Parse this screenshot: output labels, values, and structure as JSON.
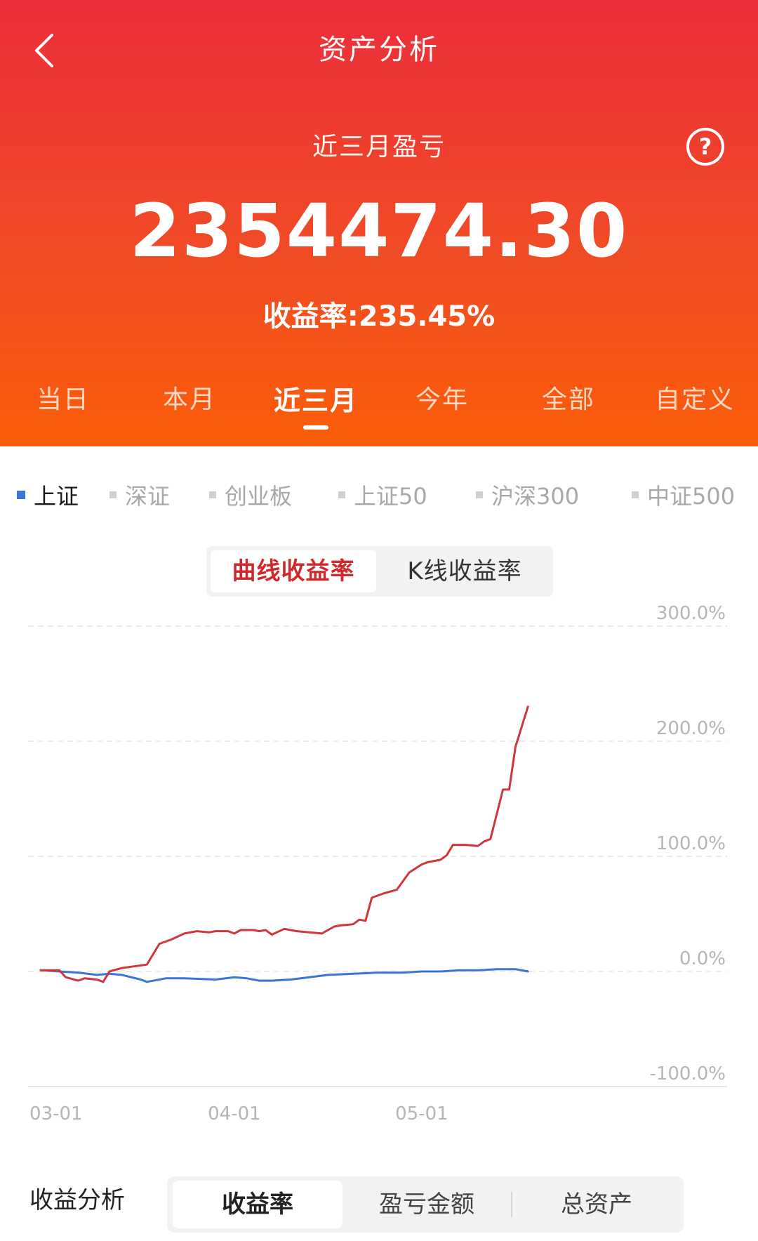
{
  "header": {
    "title": "资产分析",
    "subtitle": "近三月盈亏",
    "amount": "2354474.30",
    "yield_text": "收益率:235.45%",
    "back_icon": "chevron-left-icon",
    "help_icon": "question-circle-icon"
  },
  "period_tabs": [
    {
      "label": "当日",
      "active": false
    },
    {
      "label": "本月",
      "active": false
    },
    {
      "label": "近三月",
      "active": true
    },
    {
      "label": "今年",
      "active": false
    },
    {
      "label": "全部",
      "active": false
    },
    {
      "label": "自定义",
      "active": false
    }
  ],
  "indices": [
    {
      "label": "上证",
      "active": true
    },
    {
      "label": "深证",
      "active": false
    },
    {
      "label": "创业板",
      "active": false
    },
    {
      "label": "上证50",
      "active": false
    },
    {
      "label": "沪深300",
      "active": false
    },
    {
      "label": "中证500",
      "active": false
    }
  ],
  "chart_toggle": [
    "曲线收益率",
    "K线收益率"
  ],
  "colors": {
    "portfolio_line": "#d0373b",
    "index_line": "#3a76d6",
    "header_top": "#ec2e3a",
    "header_bottom": "#fb5d09"
  },
  "chart_data": {
    "type": "line",
    "y_ticks": [
      "300.0%",
      "200.0%",
      "100.0%",
      "0.0%",
      "-100.0%"
    ],
    "x_ticks": [
      {
        "label": "03-01",
        "day": 0
      },
      {
        "label": "04-01",
        "day": 31
      },
      {
        "label": "05-01",
        "day": 61
      }
    ],
    "ylim": [
      -100,
      300
    ],
    "grid": true,
    "series": [
      {
        "color": "#d0373b",
        "points": [
          [
            0,
            1
          ],
          [
            3,
            1
          ],
          [
            4,
            -5
          ],
          [
            6,
            -8
          ],
          [
            7,
            -6
          ],
          [
            9,
            -7
          ],
          [
            10,
            -9
          ],
          [
            11,
            0
          ],
          [
            13,
            3
          ],
          [
            17,
            6
          ],
          [
            19,
            24
          ],
          [
            21,
            28
          ],
          [
            23,
            33
          ],
          [
            25,
            35
          ],
          [
            27,
            34
          ],
          [
            28,
            35
          ],
          [
            30,
            35
          ],
          [
            31,
            33
          ],
          [
            32,
            36
          ],
          [
            34,
            36
          ],
          [
            35,
            35
          ],
          [
            36,
            36
          ],
          [
            37,
            32
          ],
          [
            39,
            37
          ],
          [
            41,
            35
          ],
          [
            43,
            34
          ],
          [
            45,
            33
          ],
          [
            47,
            39
          ],
          [
            48,
            40
          ],
          [
            50,
            41
          ],
          [
            51,
            45
          ],
          [
            52,
            44
          ],
          [
            53,
            64
          ],
          [
            55,
            68
          ],
          [
            57,
            71
          ],
          [
            59,
            86
          ],
          [
            61,
            93
          ],
          [
            62,
            95
          ],
          [
            64,
            97
          ],
          [
            65,
            101
          ],
          [
            66,
            110
          ],
          [
            68,
            110
          ],
          [
            70,
            109
          ],
          [
            71,
            113
          ],
          [
            72,
            115
          ],
          [
            74,
            158
          ],
          [
            75,
            158
          ],
          [
            76,
            195
          ],
          [
            78,
            230
          ]
        ]
      },
      {
        "color": "#3a76d6",
        "points": [
          [
            0,
            1
          ],
          [
            3,
            0
          ],
          [
            6,
            -1
          ],
          [
            9,
            -3
          ],
          [
            11,
            -2
          ],
          [
            13,
            -3
          ],
          [
            16,
            -7
          ],
          [
            17,
            -9
          ],
          [
            20,
            -6
          ],
          [
            23,
            -6
          ],
          [
            28,
            -7
          ],
          [
            31,
            -5
          ],
          [
            33,
            -6
          ],
          [
            35,
            -8
          ],
          [
            37,
            -8
          ],
          [
            40,
            -7
          ],
          [
            43,
            -5
          ],
          [
            46,
            -3
          ],
          [
            50,
            -2
          ],
          [
            54,
            -1
          ],
          [
            58,
            -1
          ],
          [
            61,
            0
          ],
          [
            64,
            0
          ],
          [
            67,
            1
          ],
          [
            70,
            1
          ],
          [
            73,
            2
          ],
          [
            76,
            2
          ],
          [
            78,
            0
          ]
        ]
      }
    ]
  },
  "bottom": {
    "label": "收益分析",
    "segments": [
      {
        "label": "收益率",
        "active": true
      },
      {
        "label": "盈亏金额",
        "active": false
      },
      {
        "label": "总资产",
        "active": false
      }
    ]
  }
}
